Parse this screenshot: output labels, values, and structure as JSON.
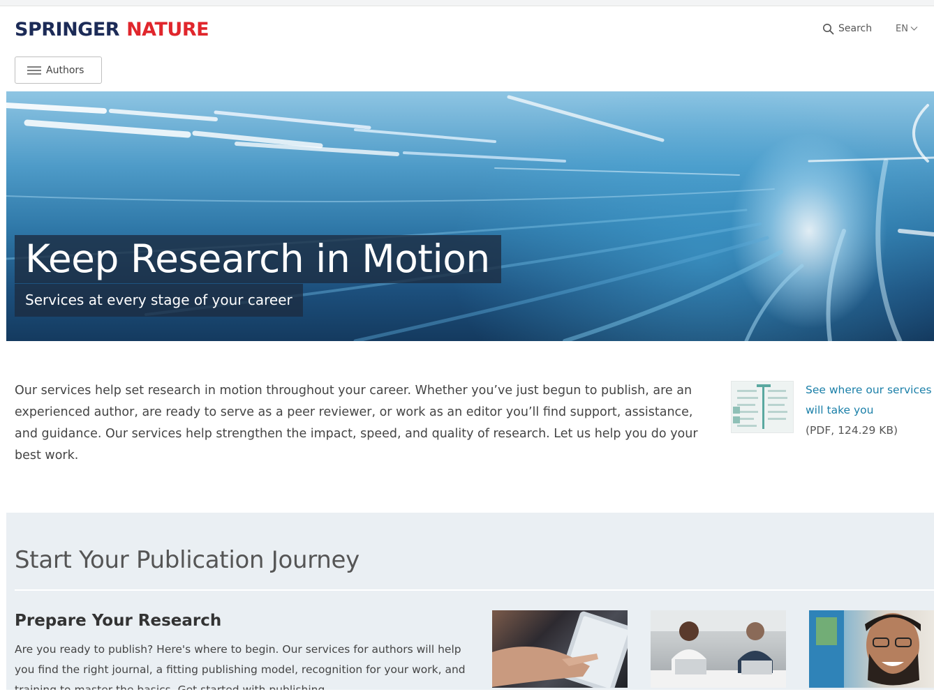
{
  "header": {
    "logo_word1": "SPRINGER",
    "logo_word2": "NATURE",
    "search_label": "Search",
    "language": "EN",
    "menu_label": "Authors"
  },
  "hero": {
    "title": "Keep Research in Motion",
    "subtitle": "Services at every stage of your career"
  },
  "intro": {
    "text": "Our services help set research in motion throughout your career. Whether you’ve just begun to publish, are an experienced author, are ready to serve as a peer reviewer, or work as an editor you’ll find support, assistance, and guidance.  Our services help strengthen the impact, speed, and quality of research. Let us help you do your best work."
  },
  "pdf": {
    "link_text": "See where our services will take you",
    "meta": "(PDF, 124.29 KB)"
  },
  "journey": {
    "title": "Start Your Publication Journey",
    "prepare_title": "Prepare Your Research",
    "prepare_text": "Are you ready to publish? Here's where to begin. Our services for authors will help you find the right journal, a fitting publishing model, recognition for your work, and training to master the basics. Get started with publishing"
  },
  "colors": {
    "brand_navy": "#1c2b57",
    "brand_red": "#e0262c",
    "link": "#1a7fa8",
    "section_bg": "#eaeff3"
  },
  "icons": {
    "search": "search-icon",
    "menu": "hamburger-icon",
    "language_dropdown": "chevron-down-icon"
  }
}
